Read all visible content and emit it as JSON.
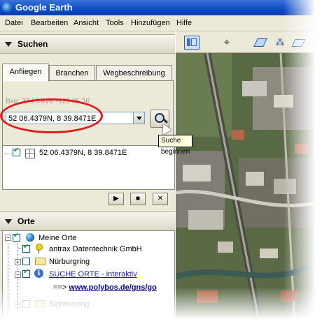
{
  "app": {
    "title": "Google Earth"
  },
  "menu": [
    "Datei",
    "Bearbeiten",
    "Ansicht",
    "Tools",
    "Hinzufügen",
    "Hilfe"
  ],
  "search_panel": {
    "title": "Suchen",
    "tabs": [
      "Anfliegen",
      "Branchen",
      "Wegbeschreibung"
    ],
    "active_tab": "Anfliegen",
    "hint": "Bsp: 37 25.818' -122 05.36'",
    "input_value": "52 06.4379N, 8 39.8471E",
    "tooltip": "Suche beginnen",
    "results": [
      {
        "label": "52 06.4379N, 8 39.8471E",
        "checked": true
      }
    ],
    "controls": [
      "play-icon",
      "stop-icon",
      "close-icon"
    ]
  },
  "places_panel": {
    "title": "Orte",
    "items": [
      {
        "label": "Meine Orte",
        "checked": true,
        "icon": "globe-icon"
      },
      {
        "label": "antrax Datentechnik GmbH",
        "checked": true,
        "icon": "pushpin-icon"
      },
      {
        "label": "Nürburgring",
        "checked": false,
        "icon": "folder-icon"
      },
      {
        "label": "SUCHE ORTE - interaktiv",
        "checked": true,
        "icon": "info-icon"
      },
      {
        "label": "==> ",
        "link": "www.polybos.de/gns/go"
      },
      {
        "label": "Sightseeing",
        "checked": false,
        "icon": "folder-icon"
      }
    ]
  },
  "colors": {
    "title_bar": "#0a4ac8",
    "highlight_oval": "#e11a1a",
    "panel_bg": "#ece9d8"
  }
}
